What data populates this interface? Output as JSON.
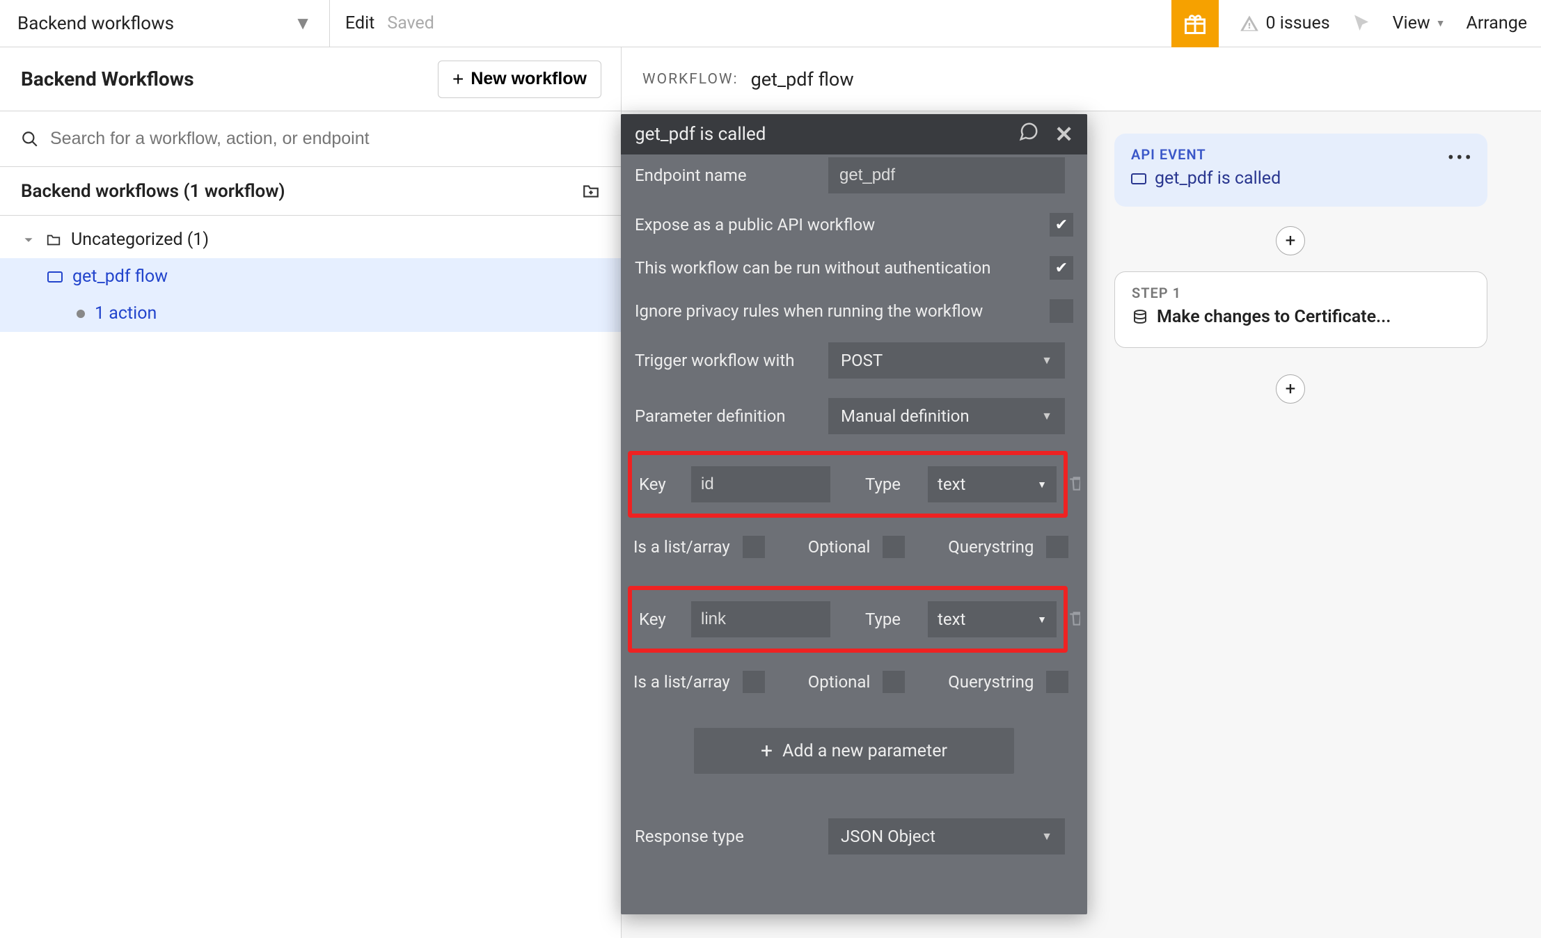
{
  "topbar": {
    "page_selector": "Backend workflows",
    "edit": "Edit",
    "saved": "Saved",
    "issues_text": "0 issues",
    "view": "View",
    "arrange": "Arrange"
  },
  "sidebar": {
    "title": "Backend Workflows",
    "new_workflow": "New workflow",
    "search_placeholder": "Search for a workflow, action, or endpoint",
    "list_header": "Backend workflows (1 workflow)",
    "folder": "Uncategorized (1)",
    "items": [
      {
        "label": "get_pdf flow",
        "selected": true
      },
      {
        "label": "1 action",
        "selected": false
      }
    ]
  },
  "workflow": {
    "label": "WORKFLOW:",
    "name": "get_pdf flow"
  },
  "event_card": {
    "tag": "API EVENT",
    "title": "get_pdf is called"
  },
  "step_card": {
    "tag": "STEP 1",
    "title": "Make changes to Certificate..."
  },
  "popup": {
    "title": "get_pdf is called",
    "fields": {
      "endpoint_label": "Endpoint name",
      "endpoint_value": "get_pdf",
      "expose_label": "Expose as a public API workflow",
      "expose_checked": true,
      "noauth_label": "This workflow can be run without authentication",
      "noauth_checked": true,
      "ignore_label": "Ignore privacy rules when running the workflow",
      "ignore_checked": false,
      "trigger_label": "Trigger workflow with",
      "trigger_value": "POST",
      "paramdef_label": "Parameter definition",
      "paramdef_value": "Manual definition",
      "response_label": "Response type",
      "response_value": "JSON Object"
    },
    "param_labels": {
      "key": "Key",
      "type": "Type",
      "is_list": "Is a list/array",
      "optional": "Optional",
      "querystring": "Querystring"
    },
    "parameters": [
      {
        "key": "id",
        "type": "text",
        "is_list": false,
        "optional": false,
        "querystring": false
      },
      {
        "key": "link",
        "type": "text",
        "is_list": false,
        "optional": false,
        "querystring": false
      }
    ],
    "add_param": "Add a new parameter"
  }
}
